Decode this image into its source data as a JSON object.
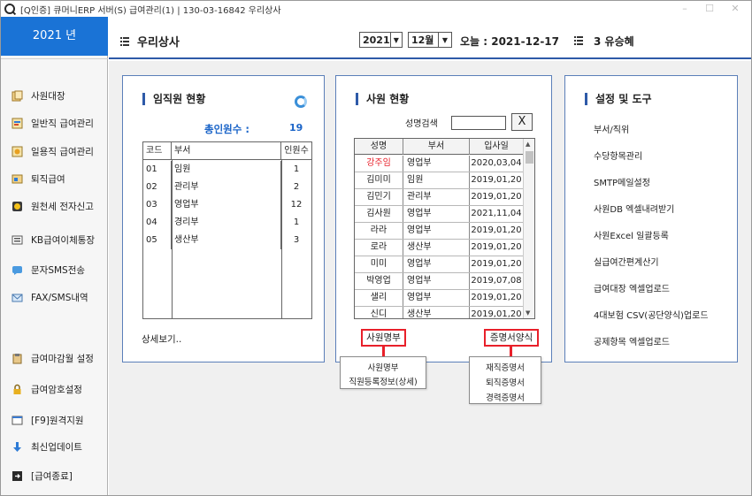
{
  "titlebar": {
    "title": "[Q인증] 큐머니ERP 서버(S)   급여관리(1)  | 130-03-16842  우리상사",
    "minimize": "–",
    "maximize": "☐",
    "close": "✕"
  },
  "sidebar": {
    "year_banner": "2021 년",
    "items": [
      {
        "label": "사원대장",
        "icon": "ledger-icon"
      },
      {
        "label": "일반직 급여관리",
        "icon": "payroll-icon"
      },
      {
        "label": "일용직 급여관리",
        "icon": "daily-payroll-icon"
      },
      {
        "label": "퇴직급여",
        "icon": "retirement-icon"
      },
      {
        "label": "원천세 전자신고",
        "icon": "tax-filing-icon"
      },
      {
        "label": "KB급여이체통장",
        "icon": "bank-transfer-icon"
      },
      {
        "label": "문자SMS전송",
        "icon": "sms-icon"
      },
      {
        "label": "FAX/SMS내역",
        "icon": "fax-icon"
      },
      {
        "label": "급여마감월 설정",
        "icon": "clipboard-icon"
      },
      {
        "label": "급여암호설정",
        "icon": "lock-icon"
      },
      {
        "label": "[F9]원격지원",
        "icon": "remote-support-icon"
      },
      {
        "label": "최신업데이트",
        "icon": "download-icon"
      },
      {
        "label": "[급여종료]",
        "icon": "exit-icon"
      }
    ]
  },
  "header": {
    "company": "우리상사",
    "year_select": "2021",
    "month_select": "12월",
    "today": "오늘 : 2021-12-17",
    "user": "3 유승혜"
  },
  "staff_panel": {
    "title": "임직원 현황",
    "total_label": "총인원수 :",
    "total_value": "19",
    "columns": [
      "코드",
      "부서",
      "인원수"
    ],
    "rows": [
      [
        "01",
        "임원",
        "1"
      ],
      [
        "02",
        "관리부",
        "2"
      ],
      [
        "03",
        "영업부",
        "12"
      ],
      [
        "04",
        "경리부",
        "1"
      ],
      [
        "05",
        "생산부",
        "3"
      ]
    ],
    "detail_link": "상세보기.."
  },
  "employee_panel": {
    "title": "사원 현황",
    "search_label": "성명검색",
    "search_value": "",
    "clear_button": "X",
    "columns": [
      "성명",
      "부서",
      "입사일"
    ],
    "rows": [
      {
        "name": "강주임",
        "dept": "영업부",
        "date": "2020,03,04",
        "highlight": true
      },
      {
        "name": "김미미",
        "dept": "임원",
        "date": "2019,01,20"
      },
      {
        "name": "김민기",
        "dept": "관리부",
        "date": "2019,01,20"
      },
      {
        "name": "김사원",
        "dept": "영업부",
        "date": "2021,11,04"
      },
      {
        "name": "라라",
        "dept": "영업부",
        "date": "2019,01,20"
      },
      {
        "name": "로라",
        "dept": "생산부",
        "date": "2019,01,20"
      },
      {
        "name": "미미",
        "dept": "영업부",
        "date": "2019,01,20"
      },
      {
        "name": "박영업",
        "dept": "영업부",
        "date": "2019,07,08"
      },
      {
        "name": "샐리",
        "dept": "영업부",
        "date": "2019,01,20"
      },
      {
        "name": "신디",
        "dept": "생산부",
        "date": "2019,01,20"
      }
    ],
    "roster_button": "사원명부",
    "certificate_button": "증명서양식",
    "roster_menu": [
      "사원명부",
      "직원등록정보(상세)"
    ],
    "certificate_menu": [
      "재직증명서",
      "퇴직증명서",
      "경력증명서"
    ]
  },
  "tools_panel": {
    "title": "설정 및 도구",
    "items": [
      "부서/직위",
      "수당항목관리",
      "SMTP메일설정",
      "사원DB 엑셀내려받기",
      "사원Excel 일괄등록",
      "실급여간편계산기",
      "급여대장 엑셀업로드",
      "4대보험 CSV(공단양식)업로드",
      "공제항목 엑셀업로드"
    ]
  },
  "colors": {
    "brand_blue": "#1a73d6",
    "accent_blue": "#2e5aa8",
    "highlight_red": "#e8202a"
  }
}
